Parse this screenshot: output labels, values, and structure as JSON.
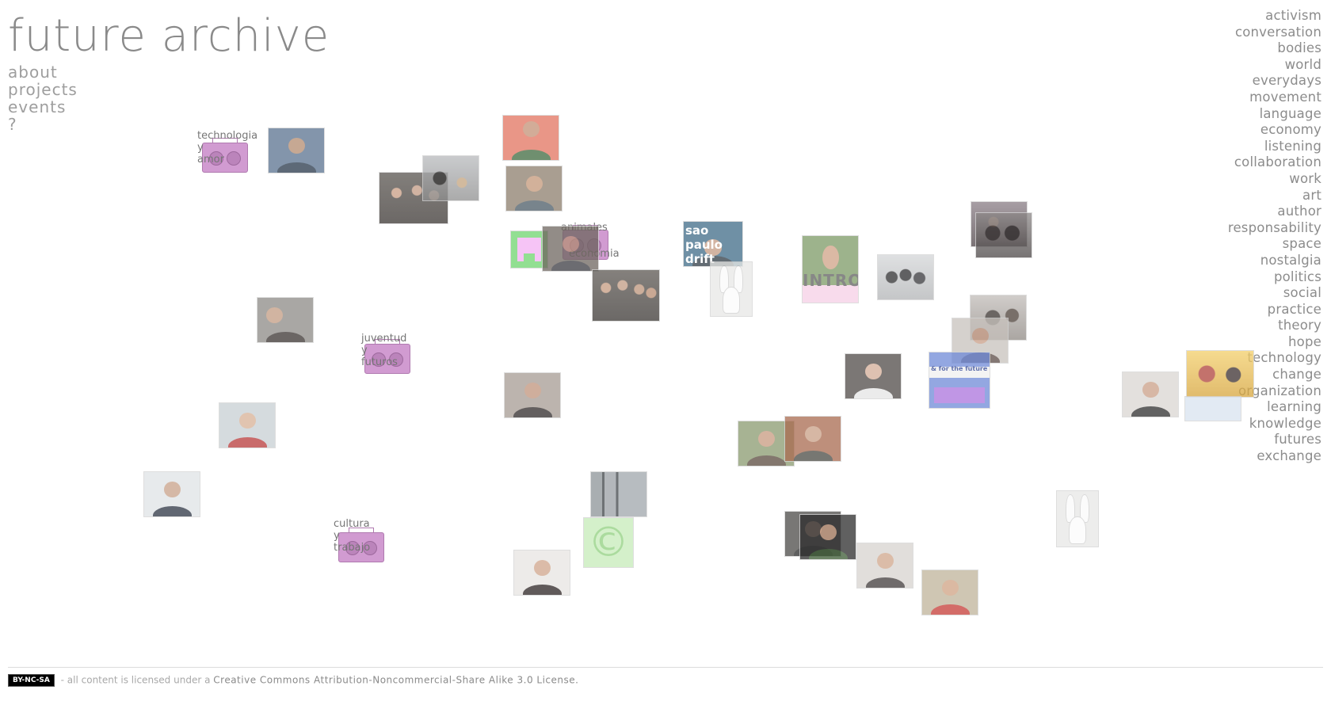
{
  "site": {
    "title": "future archive",
    "nav": [
      "about",
      "projects",
      "events",
      "?"
    ]
  },
  "tags": [
    "activism",
    "conversation",
    "bodies",
    "world",
    "everydays",
    "movement",
    "language",
    "economy",
    "listening",
    "collaboration",
    "work",
    "art",
    "author",
    "responsability",
    "space",
    "nostalgia",
    "politics",
    "social",
    "practice",
    "theory",
    "hope",
    "technology",
    "change",
    "organization",
    "learning",
    "knowledge",
    "futures",
    "exchange"
  ],
  "projects": {
    "technologia": {
      "l1": "technologia",
      "l2": "y",
      "l3": "amor"
    },
    "juventud": {
      "l1": "juventud",
      "l2": "y",
      "l3": "futuros"
    },
    "cultura": {
      "l1": "cultura",
      "l2": "y",
      "l3": "trabajo"
    },
    "animales": {
      "l1": "animales",
      "l2": "economia"
    }
  },
  "overlays": {
    "sao_paulo": [
      "sao",
      "paulo",
      "drift"
    ],
    "intro": "INTRO",
    "for_the_future": "& for the future",
    "copyright_symbol": "©"
  },
  "footer": {
    "badge": "BY-NC-SA",
    "prefix": "- all content is licensed under a",
    "license_link": "Creative Commons Attribution-Noncommercial-Share Alike 3.0 License."
  },
  "colors": {
    "title": "#8a8a8a",
    "radio": "#c98ac9",
    "accent_green": "#77d877"
  }
}
